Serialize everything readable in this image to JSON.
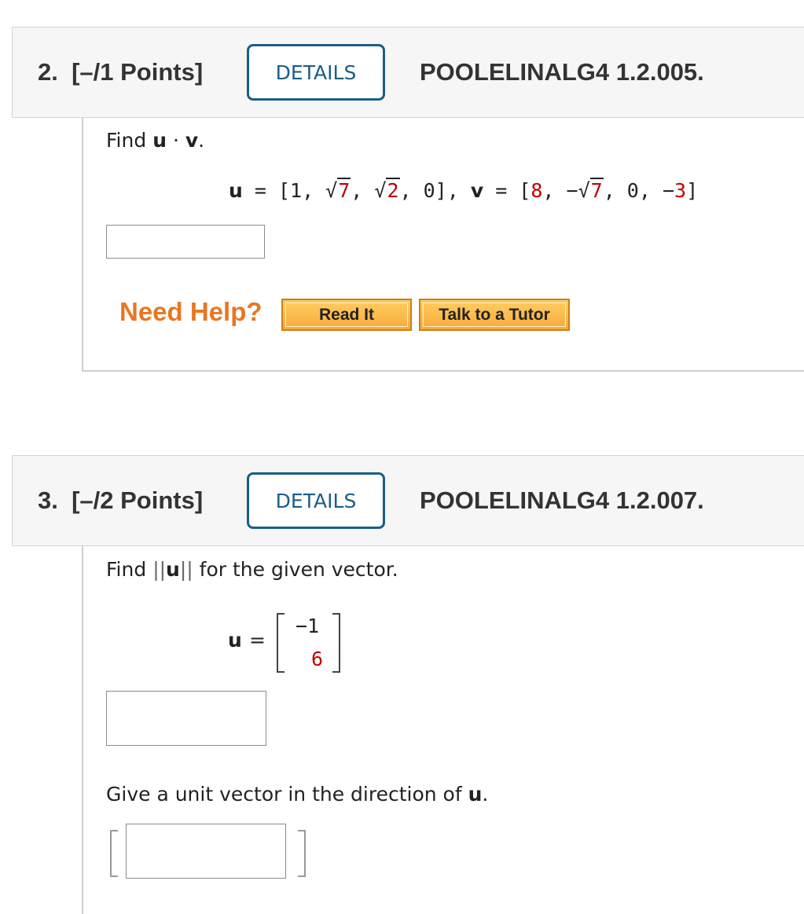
{
  "q2": {
    "number": "2.",
    "points": "[–/1 Points]",
    "details_label": "DETAILS",
    "code": "POOLELINALG4 1.2.005.",
    "prompt_find": "Find",
    "prompt_u": "u",
    "prompt_dot": "·",
    "prompt_v": "v",
    "prompt_period": ".",
    "eq": {
      "u_name": "u",
      "u_open": " = [1, ",
      "u_sqrt1": "7",
      "u_sep1": ", ",
      "u_sqrt2": "2",
      "u_close": ", 0], ",
      "v_name": "v",
      "v_open": " = [",
      "v_8": "8",
      "v_sep1": ", −",
      "v_sqrt": "7",
      "v_sep2": ", 0, −",
      "v_3": "3",
      "v_close": "]"
    },
    "need_help": "Need Help?",
    "read_it": "Read It",
    "talk_tutor": "Talk to a Tutor"
  },
  "q3": {
    "number": "3.",
    "points": "[–/2 Points]",
    "details_label": "DETAILS",
    "code": "POOLELINALG4 1.2.007.",
    "prompt_find": "Find",
    "prompt_norm_u": "u",
    "prompt_rest": "for the given vector.",
    "u_label": "u",
    "equals": "=",
    "vector_top": "−1",
    "vector_bottom": "6",
    "unit_prompt": "Give a unit vector in the direction of",
    "unit_u": "u",
    "unit_period": "."
  },
  "colors": {
    "accent_blue": "#1a5e86",
    "help_orange": "#e87722",
    "value_red": "#c00000"
  }
}
